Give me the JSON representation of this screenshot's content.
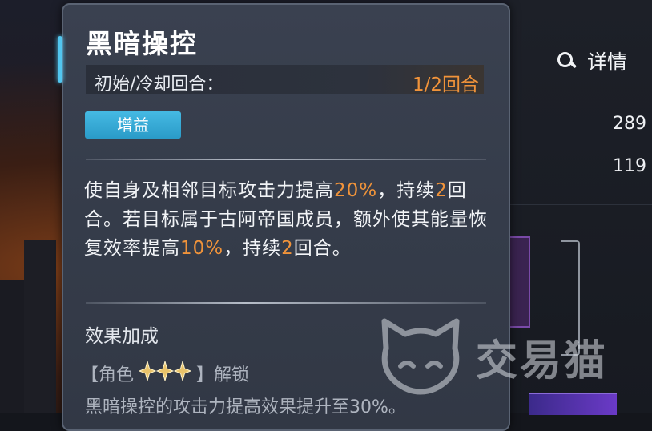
{
  "tooltip": {
    "title": "黑暗操控",
    "cooldown_label": "初始/冷却回合：",
    "cooldown_value": "1/2回合",
    "tag": "增益",
    "description": {
      "p1": "使自身及相邻目标攻击力提高",
      "v1": "20%",
      "p2": "，持续",
      "v2": "2",
      "p3": "回合。若目标属于古阿帝国成员，额外使其能量恢复效率提高",
      "v3": "10%",
      "p4": "，持续",
      "v4": "2",
      "p5": "回合。"
    },
    "bonus_header": "效果加成",
    "unlock": {
      "open_bracket": "【角色",
      "stars": 3,
      "close": "】解锁"
    },
    "bonus_text": "黑暗操控的攻击力提高效果提升至30%。"
  },
  "right_panel": {
    "detail_label": "详情",
    "stat1": "289",
    "stat2": "119"
  },
  "watermark": "交易猫",
  "colors": {
    "highlight": "#f0933a",
    "tag_bg": "#2a9bc8",
    "accent": "#52c6ef"
  }
}
